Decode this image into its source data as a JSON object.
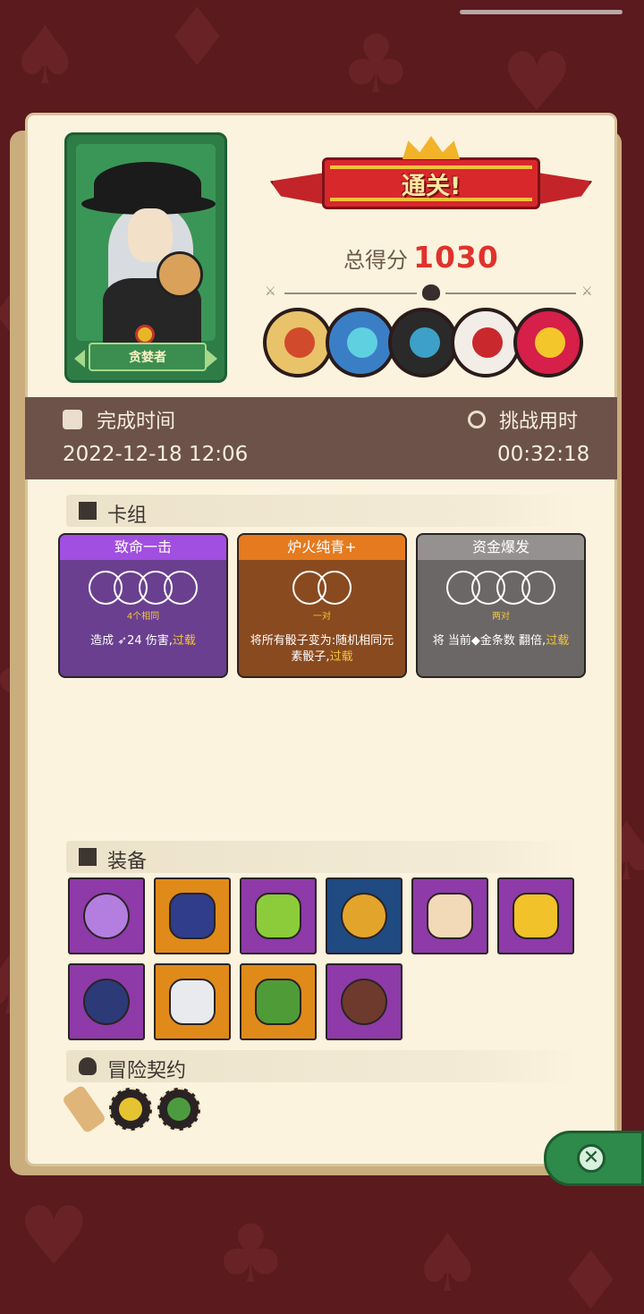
{
  "character": {
    "name": "贪婪者"
  },
  "result": {
    "title": "通关!",
    "score_label": "总得分",
    "score": "1030"
  },
  "bosses": [
    {
      "name": "cyclops-boss-icon",
      "bg": "#e9c36a",
      "accent": "#d24a2c"
    },
    {
      "name": "crowned-squid-boss-icon",
      "bg": "#3a7fc6",
      "accent": "#5fd0e0"
    },
    {
      "name": "fish-boss-icon",
      "bg": "#2a2a2a",
      "accent": "#3da0c8"
    },
    {
      "name": "demon-mask-boss-icon",
      "bg": "#f2ede6",
      "accent": "#c9282c"
    },
    {
      "name": "rainbow-boss-icon",
      "bg": "#d61f49",
      "accent": "#f3c62b"
    }
  ],
  "time": {
    "finish_label": "完成时间",
    "finish_value": "2022-12-18 12:06",
    "duration_label": "挑战用时",
    "duration_value": "00:32:18"
  },
  "deck": {
    "header": "卡组",
    "cards": [
      {
        "name": "致命一击",
        "requirement": "4个相同",
        "desc": "造成 ➶24 伤害,",
        "overload": "过载",
        "color": "#6a3f8f",
        "header_color": "#a14fe0"
      },
      {
        "name": "炉火纯青+",
        "requirement": "一对",
        "desc": "将所有骰子变为:随机相同元素骰子,",
        "overload": "过载",
        "color": "#8a4a1f",
        "header_color": "#e57a1e"
      },
      {
        "name": "资金爆发",
        "requirement": "两对",
        "desc": "将 当前◆金条数 翻倍,",
        "overload": "过载",
        "color": "#6b6766",
        "header_color": "#959190"
      }
    ]
  },
  "equipment": {
    "header": "装备",
    "items": [
      {
        "name": "potion-icon",
        "bg": "#8e3aa8",
        "color": "#b37ee0"
      },
      {
        "name": "hexagram-icon",
        "bg": "#e08a1a",
        "color": "#2f3d8a"
      },
      {
        "name": "herb-leaves-icon",
        "bg": "#8e3aa8",
        "color": "#8ccc3b"
      },
      {
        "name": "belt-icon",
        "bg": "#1f4a82",
        "color": "#e3a42b"
      },
      {
        "name": "sun-mask-icon",
        "bg": "#8e3aa8",
        "color": "#f2d9b8"
      },
      {
        "name": "fire-heart-icon",
        "bg": "#8e3aa8",
        "color": "#f2c22a"
      },
      {
        "name": "feather-quill-icon",
        "bg": "#8e3aa8",
        "color": "#2c3a78"
      },
      {
        "name": "white-dice-icon",
        "bg": "#e08a1a",
        "color": "#e8eaee"
      },
      {
        "name": "moss-stone-icon",
        "bg": "#e08a1a",
        "color": "#4f9b38"
      },
      {
        "name": "button-disc-icon",
        "bg": "#8e3aa8",
        "color": "#6e3a2e"
      }
    ]
  },
  "contracts": {
    "header": "冒险契约",
    "items": [
      {
        "name": "scroll-icon",
        "color": "#e0b57a"
      },
      {
        "name": "gold-coin-icon",
        "color": "#e6c330"
      },
      {
        "name": "green-gem-icon",
        "color": "#4d9b3f"
      }
    ]
  }
}
